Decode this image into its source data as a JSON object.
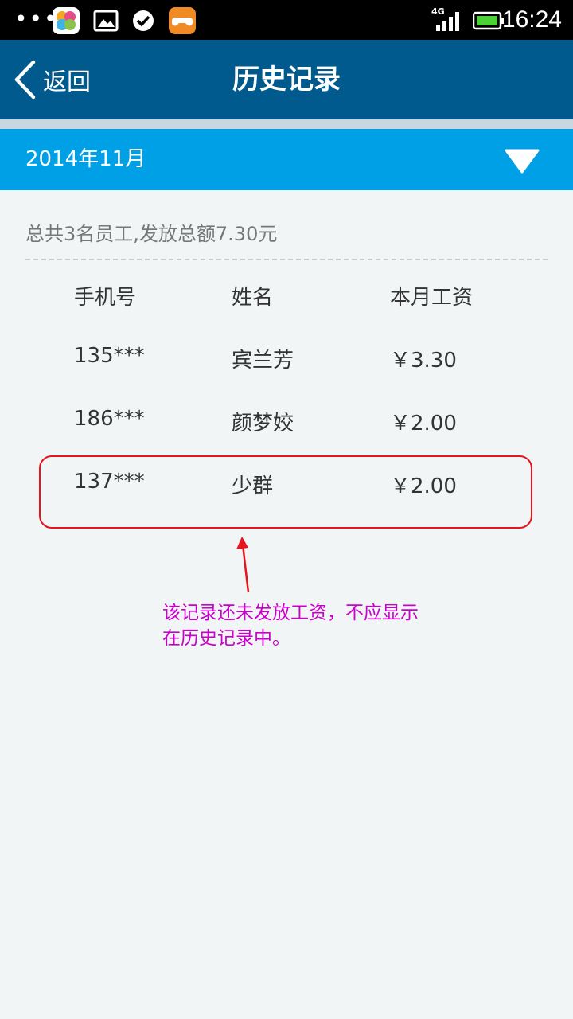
{
  "status_bar": {
    "dots": "•••",
    "network": "4G",
    "time": "16:24",
    "icons": [
      "flower-app-icon",
      "gallery-icon",
      "check-icon",
      "game-controller-icon"
    ]
  },
  "header": {
    "back_label": "返回",
    "title": "历史记录"
  },
  "month_selector": {
    "label": "2014年11月"
  },
  "summary": "总共3名员工,发放总额7.30元",
  "table": {
    "headers": [
      "手机号",
      "姓名",
      "本月工资"
    ],
    "rows": [
      [
        "135***",
        "宾兰芳",
        "￥3.30"
      ],
      [
        "186***",
        "颜梦姣",
        "￥2.00"
      ],
      [
        "137***",
        "少群",
        "￥2.00"
      ]
    ]
  },
  "annotation": {
    "note": "该记录还未发放工资，不应显示在历史记录中。"
  },
  "colors": {
    "title_bar": "#005a8d",
    "month_bar": "#00a0e6",
    "background": "#f1f5f6",
    "annotation_border": "#e8141d",
    "annotation_text": "#cc00cc"
  }
}
